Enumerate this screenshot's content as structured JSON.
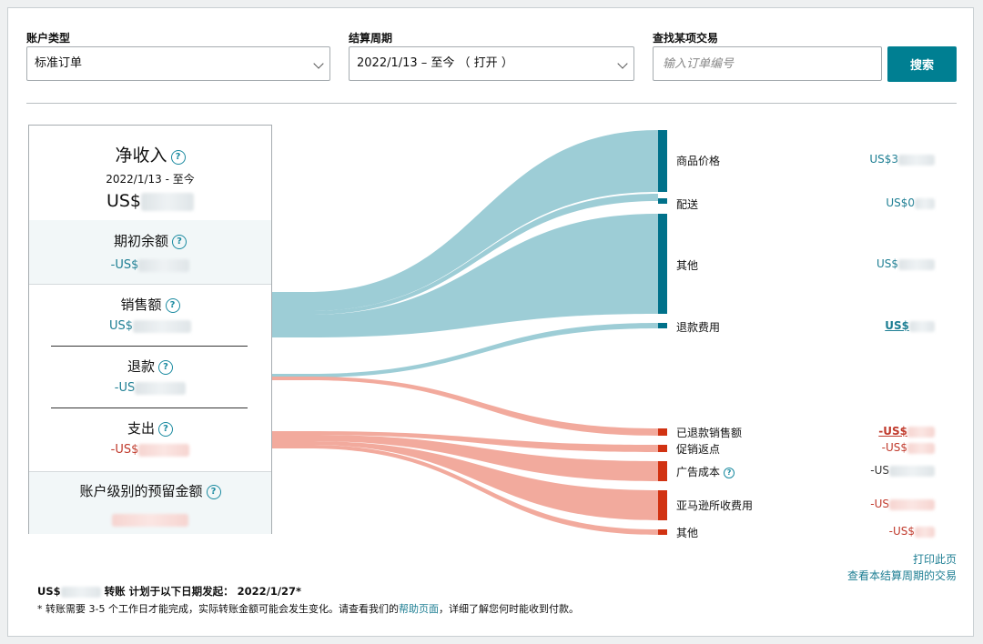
{
  "filters": {
    "account_type": {
      "label": "账户类型",
      "value": "标准订单"
    },
    "period": {
      "label": "结算周期",
      "value": "2022/1/13 – 至今 （ 打开 ）"
    },
    "search": {
      "label": "查找某项交易",
      "placeholder": "输入订单编号",
      "button": "搜索"
    }
  },
  "summary": {
    "title": "净收入",
    "date_range": "2022/1/13 - 至今",
    "net_prefix": "US$",
    "opening": {
      "label": "期初余额",
      "prefix": "-US$"
    },
    "sales": {
      "label": "销售额",
      "prefix": "US$"
    },
    "refunds": {
      "label": "退款",
      "prefix": "-US"
    },
    "expenses": {
      "label": "支出",
      "prefix": "-US$"
    },
    "reserve": {
      "label": "账户级别的预留金额"
    }
  },
  "income_items": [
    {
      "label": "商品价格",
      "value": "US$3"
    },
    {
      "label": "配送",
      "value": "US$0"
    },
    {
      "label": "其他",
      "value": "US$"
    },
    {
      "label": "退款费用",
      "value": "US$"
    }
  ],
  "expense_items": [
    {
      "label": "已退款销售额",
      "value": "-US$"
    },
    {
      "label": "促销返点",
      "value": "-US$"
    },
    {
      "label": "广告成本",
      "value": "-US"
    },
    {
      "label": "亚马逊所收费用",
      "value": "-US"
    },
    {
      "label": "其他",
      "value": "-US$"
    }
  ],
  "links": {
    "print": "打印此页",
    "view_transactions": "查看本结算周期的交易"
  },
  "footer": {
    "transfer_prefix": "US$",
    "transfer_text": "转账 计划于以下日期发起： 2022/1/27*",
    "note_prefix": "* 转账需要 3-5 个工作日才能完成，实际转账金额可能会发生变化。请查看我们的",
    "note_link": "帮助页面",
    "note_suffix": "，详细了解您何时能收到付款。"
  },
  "colors": {
    "accent": "#007f92",
    "income_flow": "#9dcdd6",
    "expense_flow": "#f2aa9d",
    "income_bar": "#00718a",
    "expense_bar": "#d13212"
  }
}
